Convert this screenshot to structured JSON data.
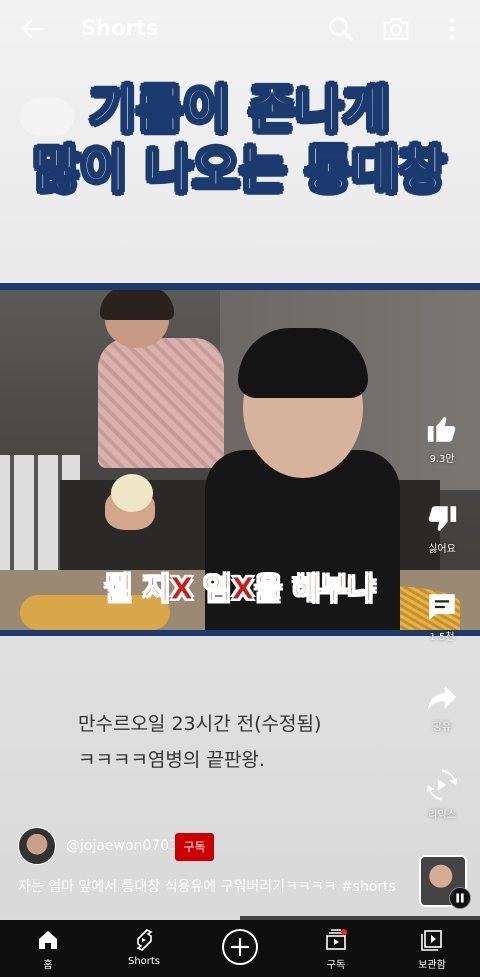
{
  "header": {
    "title": "Shorts",
    "icons": [
      "back-arrow-icon",
      "search-icon",
      "camera-icon",
      "more-vert-icon"
    ]
  },
  "video": {
    "title_line1": "기름이 존나게",
    "title_line2": "많이 나오는 통대창",
    "subtitle": "뭘 지X 염X을 해부냐",
    "caption_line1": "만수르오일 23시간 전(수정됨)",
    "caption_line2": "ㅋㅋㅋㅋ염병의 끝판왕."
  },
  "actions": {
    "like": "9.3만",
    "dislike": "싫어요",
    "comments": "1.5천",
    "share": "공유",
    "remix": "리믹스"
  },
  "channel": {
    "handle": "@jojaewon0703",
    "subscribe_label": "구독",
    "description": "자는 엄마 앞에서 통대창 식용유에 구워버리기ㅋㅋㅋㅋ #shorts"
  },
  "progress": 0.5,
  "nav": {
    "items": [
      {
        "label": "홈",
        "icon": "home-icon"
      },
      {
        "label": "Shorts",
        "icon": "shorts-icon"
      },
      {
        "label": "",
        "icon": "create-plus-icon"
      },
      {
        "label": "구독",
        "icon": "subscriptions-icon"
      },
      {
        "label": "보관함",
        "icon": "library-icon"
      }
    ]
  },
  "colors": {
    "title_stroke": "#1b3b6f",
    "subscribe_bg": "#cc0000",
    "subtitle_red": "#d41818"
  }
}
